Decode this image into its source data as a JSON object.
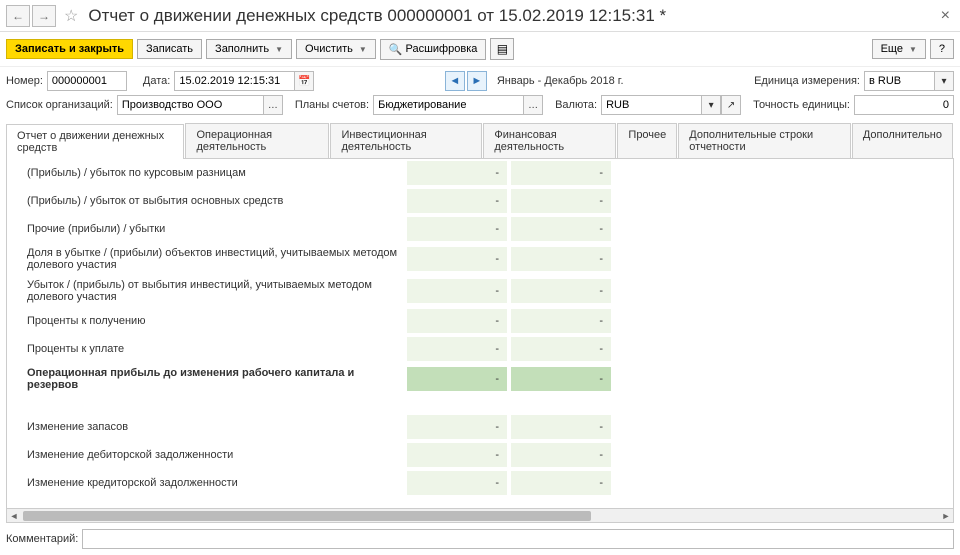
{
  "title": "Отчет о движении денежных средств 000000001 от 15.02.2019 12:15:31 *",
  "toolbar": {
    "save_close": "Записать и закрыть",
    "save": "Записать",
    "fill": "Заполнить",
    "clear": "Очистить",
    "decode": "Расшифровка",
    "more": "Еще"
  },
  "fields": {
    "number_lbl": "Номер:",
    "number": "000000001",
    "date_lbl": "Дата:",
    "date": "15.02.2019 12:15:31",
    "period": "Январь - Декабрь 2018 г.",
    "unit_lbl": "Единица измерения:",
    "unit": "в RUB",
    "orgs_lbl": "Список организаций:",
    "orgs": "Производство ООО",
    "plans_lbl": "Планы счетов:",
    "plans": "Бюджетирование",
    "currency_lbl": "Валюта:",
    "currency": "RUB",
    "precision_lbl": "Точность единицы:",
    "precision": "0"
  },
  "tabs": [
    "Отчет о движении денежных средств",
    "Операционная деятельность",
    "Инвестиционная деятельность",
    "Финансовая деятельность",
    "Прочее",
    "Дополнительные строки отчетности",
    "Дополнительно"
  ],
  "rows": [
    {
      "label": "(Прибыль) / убыток по курсовым разницам",
      "bold": false,
      "v1": "-",
      "v2": "-",
      "style": "g"
    },
    {
      "label": "(Прибыль) / убыток  от выбытия основных средств",
      "bold": false,
      "v1": "-",
      "v2": "-",
      "style": "g"
    },
    {
      "label": "Прочие (прибыли) / убытки",
      "bold": false,
      "v1": "-",
      "v2": "-",
      "style": "g"
    },
    {
      "label": "Доля в убытке / (прибыли) объектов инвестиций, учитываемых методом долевого участия",
      "bold": false,
      "v1": "-",
      "v2": "-",
      "style": "g"
    },
    {
      "label": "Убыток / (прибыль) от выбытия инвестиций, учитываемых методом долевого участия",
      "bold": false,
      "v1": "-",
      "v2": "-",
      "style": "g"
    },
    {
      "label": "Проценты к получению",
      "bold": false,
      "v1": "-",
      "v2": "-",
      "style": "g"
    },
    {
      "label": "Проценты к уплате",
      "bold": false,
      "v1": "-",
      "v2": "-",
      "style": "g"
    },
    {
      "label": "Операционная прибыль до изменения рабочего капитала и резервов",
      "bold": true,
      "v1": "-",
      "v2": "-",
      "style": "dg"
    },
    {
      "label": "",
      "bold": false,
      "v1": "",
      "v2": "",
      "style": "sp"
    },
    {
      "label": "Изменение запасов",
      "bold": false,
      "v1": "-",
      "v2": "-",
      "style": "g"
    },
    {
      "label": "Изменение дебиторской задолженности",
      "bold": false,
      "v1": "-",
      "v2": "-",
      "style": "g"
    },
    {
      "label": "Изменение кредиторской задолженности",
      "bold": false,
      "v1": "-",
      "v2": "-",
      "style": "g"
    }
  ],
  "comment_lbl": "Комментарий:",
  "comment": ""
}
